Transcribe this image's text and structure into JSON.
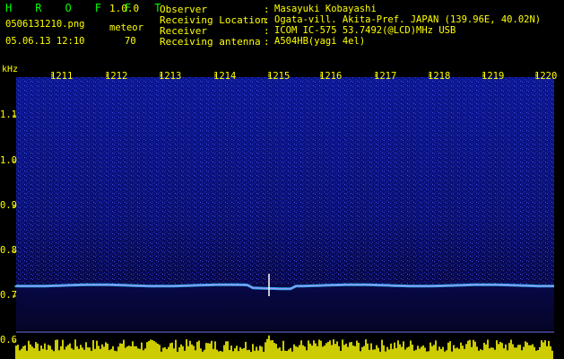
{
  "header": {
    "title": "H R O F F T",
    "version": "1.0.0",
    "filename": "0506131210.png",
    "mode_label": "meteor",
    "datetime": "05.06.13 12:10",
    "meteor_count": "70"
  },
  "info": [
    {
      "label": "Observer",
      "colon": ":",
      "value": "Masayuki Kobayashi"
    },
    {
      "label": "Receiving Location",
      "colon": ":",
      "value": "Ogata-vill. Akita-Pref. JAPAN (139.96E, 40.02N)"
    },
    {
      "label": "Receiver",
      "colon": ":",
      "value": "ICOM IC-575 53.7492(@LCD)MHz USB"
    },
    {
      "label": "Receiving antenna",
      "colon": ":",
      "value": "A504HB(yagi 4el)"
    }
  ],
  "axis": {
    "y_unit": "kHz",
    "y_ticks": [
      "1.1",
      "1.0",
      "0.9",
      "0.8",
      "0.7",
      "0.6"
    ],
    "x_ticks": [
      "1211",
      "1212",
      "1213",
      "1214",
      "1215",
      "1216",
      "1217",
      "1218",
      "1219",
      "1220"
    ]
  },
  "colors": {
    "background": "#000000",
    "text": "#ffff00",
    "title": "#00ff00",
    "noise_bright": "#2030ff",
    "noise_dark": "#101040",
    "echo_line": "#30c0ff",
    "bars": "#ffff00"
  }
}
